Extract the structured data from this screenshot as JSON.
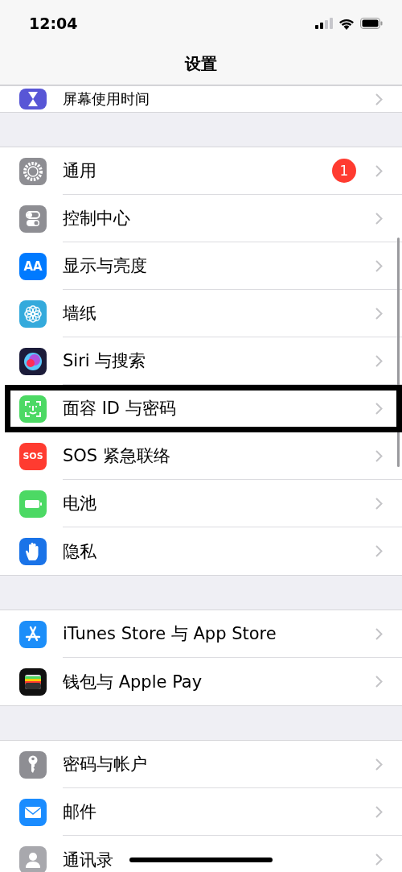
{
  "status_bar": {
    "time": "12:04"
  },
  "nav": {
    "title": "设置"
  },
  "top_row": {
    "label": "屏幕使用时间",
    "color": "#5856d6"
  },
  "groups": [
    {
      "items": [
        {
          "label": "通用",
          "color": "#8e8e93",
          "badge": "1",
          "outlined": false
        },
        {
          "label": "控制中心",
          "color": "#8e8e93",
          "outlined": false
        },
        {
          "label": "显示与亮度",
          "color": "#007aff",
          "icon_text": "AA",
          "outlined": false
        },
        {
          "label": "墙纸",
          "color": "#34aadc",
          "outlined": false
        },
        {
          "label": "Siri 与搜索",
          "color": "#1c1c3a",
          "outlined": false
        },
        {
          "label": "面容 ID 与密码",
          "color": "#4cd964",
          "outlined": true
        },
        {
          "label": "SOS 紧急联络",
          "color": "#ff3b30",
          "icon_text": "SOS",
          "outlined": false
        },
        {
          "label": "电池",
          "color": "#4cd964",
          "outlined": false
        },
        {
          "label": "隐私",
          "color": "#1a73e8",
          "outlined": false
        }
      ]
    },
    {
      "items": [
        {
          "label": "iTunes Store 与 App Store",
          "color": "#1c8ef9",
          "outlined": false
        },
        {
          "label": "钱包与 Apple Pay",
          "color": "#111111",
          "outlined": false
        }
      ]
    },
    {
      "items": [
        {
          "label": "密码与帐户",
          "color": "#8e8e93",
          "outlined": false
        },
        {
          "label": "邮件",
          "color": "#1a8cff",
          "outlined": false
        },
        {
          "label": "通讯录",
          "color": "#a8a8ad",
          "outlined": false
        }
      ]
    }
  ]
}
